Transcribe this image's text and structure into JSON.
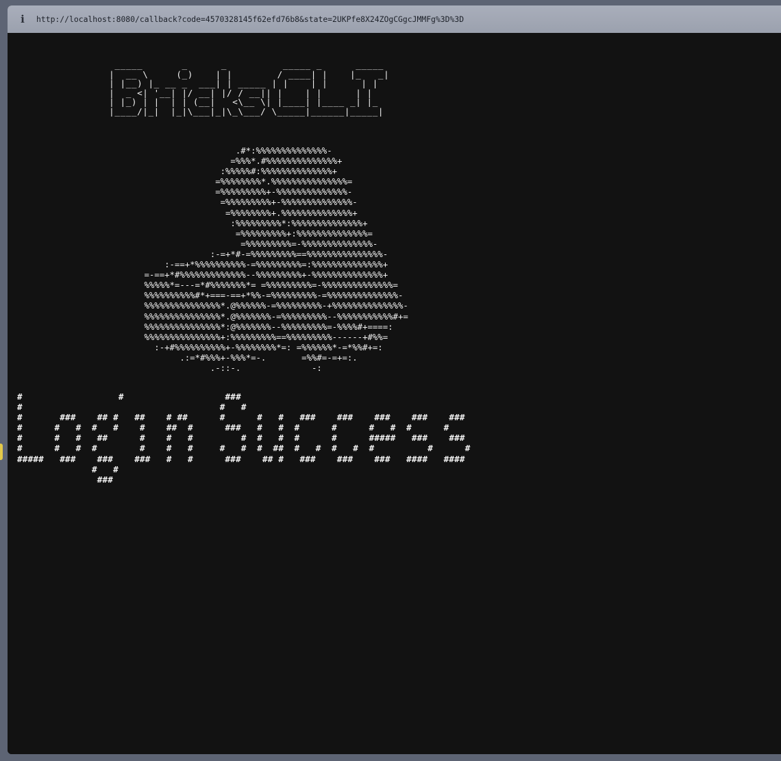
{
  "browser": {
    "url": "http://localhost:8080/callback?code=4570328145f62efd76b8&state=2UKPfe8X24ZOgCGgcJMMFg%3D%3D",
    "info_icon": "info-icon"
  },
  "terminal": {
    "logo_ascii": "  _____       _      _          _____ _      _____ \n |  __ \\     (_)    | |        / ____| |    |_   _|\n | |__) |_ __ _  ___| | _____ | |    | |      | |  \n |  _ <| '__| |/ __| |/ / __|| |    | |      | |  \n | |_) | |  | | (__|   <\\__ \\| |____| |____ _| |_ \n |____/|_|  |_|\\___|_|\\_\\___/ \\_____|______|_____|",
    "hat_ascii": "                        .#*:%%%%%%%%%%%%%%-\n                       =%%%*.#%%%%%%%%%%%%%%+\n                     :%%%%%#:%%%%%%%%%%%%%%+\n                    =%%%%%%%%*.%%%%%%%%%%%%%%%=\n                    =%%%%%%%%%+-%%%%%%%%%%%%%%-\n                     =%%%%%%%%%+-%%%%%%%%%%%%%%-\n                      =%%%%%%%%+.%%%%%%%%%%%%%%+\n                       :%%%%%%%%%*:%%%%%%%%%%%%%%+\n                        =%%%%%%%%%+:%%%%%%%%%%%%%%=\n                         =%%%%%%%%%=-%%%%%%%%%%%%%%-\n                   :-=+*#-=%%%%%%%%%==%%%%%%%%%%%%%%%-\n          :-==+*%%%%%%%%%%-=%%%%%%%%%=:%%%%%%%%%%%%%%+\n      =-==+*#%%%%%%%%%%%%%--%%%%%%%%%+-%%%%%%%%%%%%%%+\n      %%%%%*=---=*#%%%%%%%*= =%%%%%%%%%=-%%%%%%%%%%%%%%=\n      %%%%%%%%%%#*+===-==+*%%-=%%%%%%%%%-=%%%%%%%%%%%%%%-\n      %%%%%%%%%%%%%%%*.@%%%%%%-=%%%%%%%%%-+%%%%%%%%%%%%%%-\n      %%%%%%%%%%%%%%%*.@%%%%%%%-=%%%%%%%%%--%%%%%%%%%%%#+=\n      %%%%%%%%%%%%%%%*:@%%%%%%%--%%%%%%%%%=-%%%%#+====:\n      %%%%%%%%%%%%%%%+:%%%%%%%%%==%%%%%%%%%------+#%%=\n        :-+#%%%%%%%%%%+-%%%%%%%%*=: =%%%%%%*-=*%%#+=:\n             .:=*#%%%+-%%%*=-.       =%%#=-=+=:.\n                   .-::-.              -:",
    "banner_ascii": "#                  #                   ###\n#                                     #   #\n#       ###    ## #   ##    # ##      #      #   #   ###    ###    ###    ###    ###\n#      #   #  #   #    #    ##  #      ###   #   #  #      #      #   #  #      #\n#      #   #   ##      #    #   #         #  #   #  #      #      #####   ###    ###\n#      #   #  #        #    #   #     #   #  #  ##  #   #  #   #  #          #      #\n#####   ###    ###    ###   #   #      ###    ## #   ###    ###    ###   ####   ####\n              #   #\n               ###"
  }
}
